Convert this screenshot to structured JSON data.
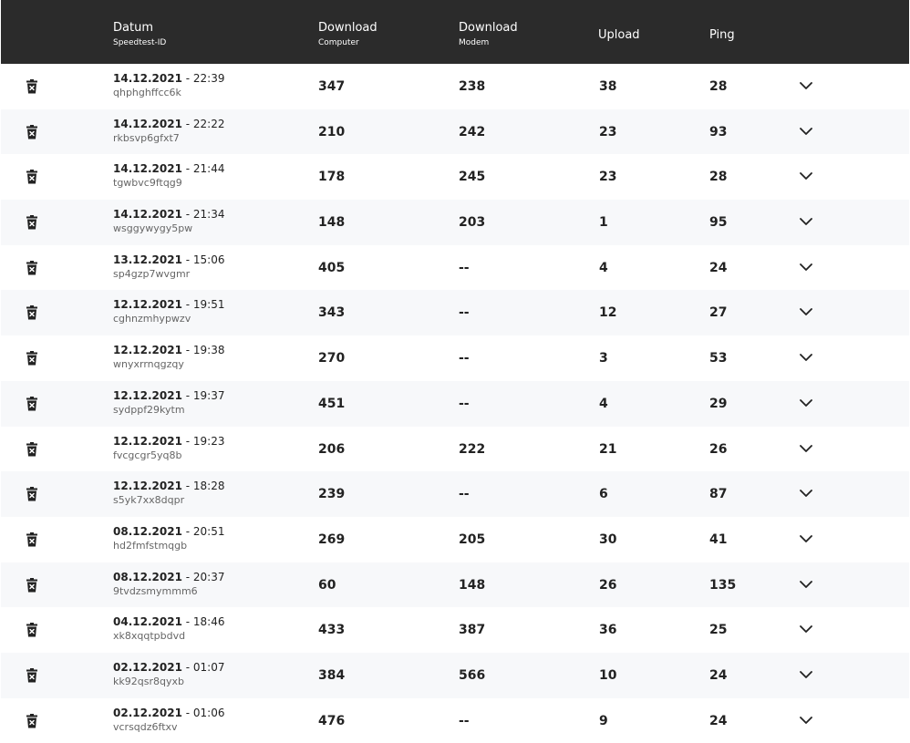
{
  "header": {
    "datum": "Datum",
    "datum_sub": "Speedtest-ID",
    "download_computer": "Download",
    "download_computer_sub": "Computer",
    "download_modem": "Download",
    "download_modem_sub": "Modem",
    "upload": "Upload",
    "ping": "Ping"
  },
  "rows": [
    {
      "date": "14.12.2021",
      "time": " - 22:39",
      "id": "qhphghffcc6k",
      "dc": "347",
      "dm": "238",
      "up": "38",
      "ping": "28"
    },
    {
      "date": "14.12.2021",
      "time": " - 22:22",
      "id": "rkbsvp6gfxt7",
      "dc": "210",
      "dm": "242",
      "up": "23",
      "ping": "93"
    },
    {
      "date": "14.12.2021",
      "time": " - 21:44",
      "id": "tgwbvc9ftqg9",
      "dc": "178",
      "dm": "245",
      "up": "23",
      "ping": "28"
    },
    {
      "date": "14.12.2021",
      "time": " - 21:34",
      "id": "wsggywygy5pw",
      "dc": "148",
      "dm": "203",
      "up": "1",
      "ping": "95"
    },
    {
      "date": "13.12.2021",
      "time": " - 15:06",
      "id": "sp4gzp7wvgmr",
      "dc": "405",
      "dm": "--",
      "up": "4",
      "ping": "24"
    },
    {
      "date": "12.12.2021",
      "time": " - 19:51",
      "id": "cghnzmhypwzv",
      "dc": "343",
      "dm": "--",
      "up": "12",
      "ping": "27"
    },
    {
      "date": "12.12.2021",
      "time": " - 19:38",
      "id": "wnyxrrnqgzqy",
      "dc": "270",
      "dm": "--",
      "up": "3",
      "ping": "53"
    },
    {
      "date": "12.12.2021",
      "time": " - 19:37",
      "id": "sydppf29kytm",
      "dc": "451",
      "dm": "--",
      "up": "4",
      "ping": "29"
    },
    {
      "date": "12.12.2021",
      "time": " - 19:23",
      "id": "fvcgcgr5yq8b",
      "dc": "206",
      "dm": "222",
      "up": "21",
      "ping": "26"
    },
    {
      "date": "12.12.2021",
      "time": " - 18:28",
      "id": "s5yk7xx8dqpr",
      "dc": "239",
      "dm": "--",
      "up": "6",
      "ping": "87"
    },
    {
      "date": "08.12.2021",
      "time": " - 20:51",
      "id": "hd2fmfstmqgb",
      "dc": "269",
      "dm": "205",
      "up": "30",
      "ping": "41"
    },
    {
      "date": "08.12.2021",
      "time": " - 20:37",
      "id": "9tvdzsmymmm6",
      "dc": "60",
      "dm": "148",
      "up": "26",
      "ping": "135"
    },
    {
      "date": "04.12.2021",
      "time": " - 18:46",
      "id": "xk8xqqtpbdvd",
      "dc": "433",
      "dm": "387",
      "up": "36",
      "ping": "25"
    },
    {
      "date": "02.12.2021",
      "time": " - 01:07",
      "id": "kk92qsr8qyxb",
      "dc": "384",
      "dm": "566",
      "up": "10",
      "ping": "24"
    },
    {
      "date": "02.12.2021",
      "time": " - 01:06",
      "id": "vcrsqdz6ftxv",
      "dc": "476",
      "dm": "--",
      "up": "9",
      "ping": "24"
    }
  ]
}
